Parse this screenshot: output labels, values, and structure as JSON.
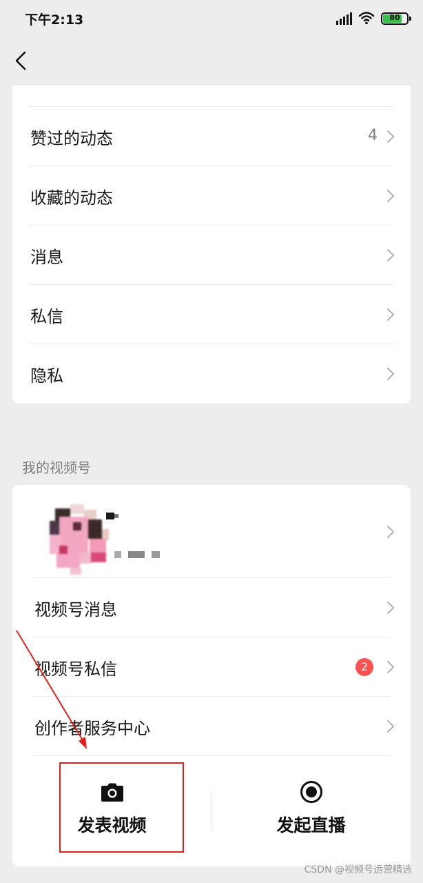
{
  "status_bar": {
    "time": "下午2:13",
    "battery": "80",
    "battery_level": 0.8
  },
  "nav": {
    "back_icon": "chevron-left-icon"
  },
  "menu": {
    "items": [
      {
        "label": "赞过的动态",
        "count": "4"
      },
      {
        "label": "收藏的动态"
      },
      {
        "label": "消息"
      },
      {
        "label": "私信"
      },
      {
        "label": "隐私"
      }
    ]
  },
  "channel": {
    "section_title": "我的视频号",
    "items": [
      {
        "label": "视频号消息"
      },
      {
        "label": "视频号私信",
        "badge": "2"
      },
      {
        "label": "创作者服务中心"
      }
    ],
    "actions": {
      "publish_label": "发表视频",
      "publish_icon": "camera-icon",
      "live_label": "发起直播",
      "live_icon": "record-icon"
    }
  },
  "colors": {
    "badge": "#fa5151",
    "annotation": "#e0201a",
    "background": "#ededed"
  },
  "watermark": "CSDN @视频号运营精选"
}
